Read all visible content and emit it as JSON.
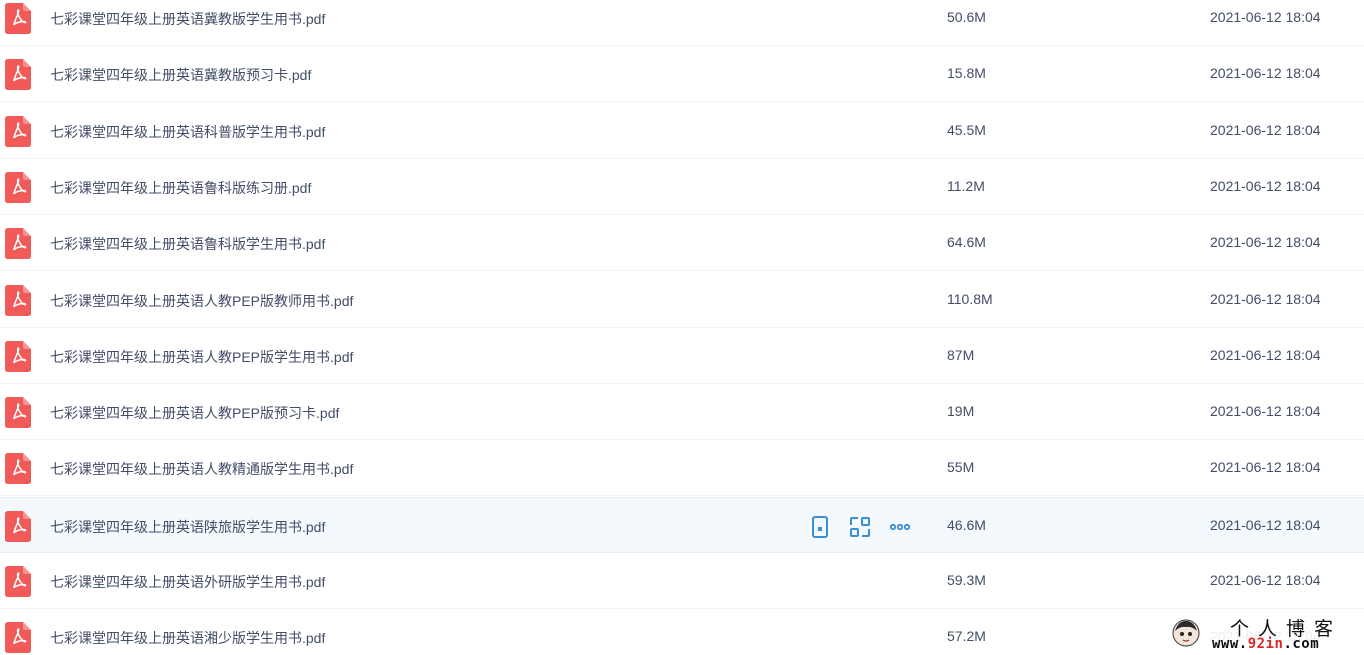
{
  "colors": {
    "pdf_icon": "#f25959",
    "text": "#424e67",
    "action_icon": "#3a8fd6",
    "hover_bg": "#f3f9fd"
  },
  "files": [
    {
      "name": "七彩课堂四年级上册英语冀教版学生用书.pdf",
      "size": "50.6M",
      "date": "2021-06-12 18:04"
    },
    {
      "name": "七彩课堂四年级上册英语冀教版预习卡.pdf",
      "size": "15.8M",
      "date": "2021-06-12 18:04"
    },
    {
      "name": "七彩课堂四年级上册英语科普版学生用书.pdf",
      "size": "45.5M",
      "date": "2021-06-12 18:04"
    },
    {
      "name": "七彩课堂四年级上册英语鲁科版练习册.pdf",
      "size": "11.2M",
      "date": "2021-06-12 18:04"
    },
    {
      "name": "七彩课堂四年级上册英语鲁科版学生用书.pdf",
      "size": "64.6M",
      "date": "2021-06-12 18:04"
    },
    {
      "name": "七彩课堂四年级上册英语人教PEP版教师用书.pdf",
      "size": "110.8M",
      "date": "2021-06-12 18:04"
    },
    {
      "name": "七彩课堂四年级上册英语人教PEP版学生用书.pdf",
      "size": "87M",
      "date": "2021-06-12 18:04"
    },
    {
      "name": "七彩课堂四年级上册英语人教PEP版预习卡.pdf",
      "size": "19M",
      "date": "2021-06-12 18:04"
    },
    {
      "name": "七彩课堂四年级上册英语人教精通版学生用书.pdf",
      "size": "55M",
      "date": "2021-06-12 18:04"
    },
    {
      "name": "七彩课堂四年级上册英语陕旅版学生用书.pdf",
      "size": "46.6M",
      "date": "2021-06-12 18:04",
      "hovered": true
    },
    {
      "name": "七彩课堂四年级上册英语外研版学生用书.pdf",
      "size": "59.3M",
      "date": "2021-06-12 18:04"
    },
    {
      "name": "七彩课堂四年级上册英语湘少版学生用书.pdf",
      "size": "57.2M",
      "date": "2021-06-12 18:04"
    }
  ],
  "row_actions": [
    {
      "icon": "phone-icon"
    },
    {
      "icon": "share-icon"
    },
    {
      "icon": "more-icon"
    }
  ],
  "watermark": {
    "title": "个人博客",
    "url_prefix": "www.",
    "url_accent": "92in",
    "url_suffix": ".com"
  }
}
